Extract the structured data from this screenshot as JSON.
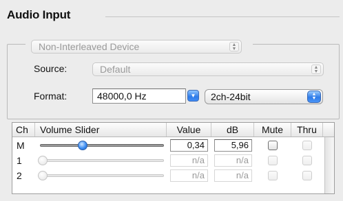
{
  "section": {
    "title": "Audio Input"
  },
  "device": {
    "label": "Non-Interleaved Device"
  },
  "source": {
    "label": "Source:",
    "value": "Default"
  },
  "format": {
    "label": "Format:",
    "sample_rate": "48000,0 Hz",
    "bit_format": "2ch-24bit"
  },
  "table": {
    "headers": {
      "ch": "Ch",
      "slider": "Volume Slider",
      "value": "Value",
      "db": "dB",
      "mute": "Mute",
      "thru": "Thru"
    },
    "rows": [
      {
        "ch": "M",
        "level": 0.34,
        "value": "0,34",
        "db": "5,96",
        "enabled": true
      },
      {
        "ch": "1",
        "level": 0.0,
        "value": "n/a",
        "db": "n/a",
        "enabled": false
      },
      {
        "ch": "2",
        "level": 0.0,
        "value": "n/a",
        "db": "n/a",
        "enabled": false
      }
    ]
  },
  "colors": {
    "accent": "#2f7ce8",
    "background": "#ececec"
  },
  "icons": {
    "popup_arrows": "updown-arrows-icon",
    "knob": "slider-knob-icon"
  }
}
